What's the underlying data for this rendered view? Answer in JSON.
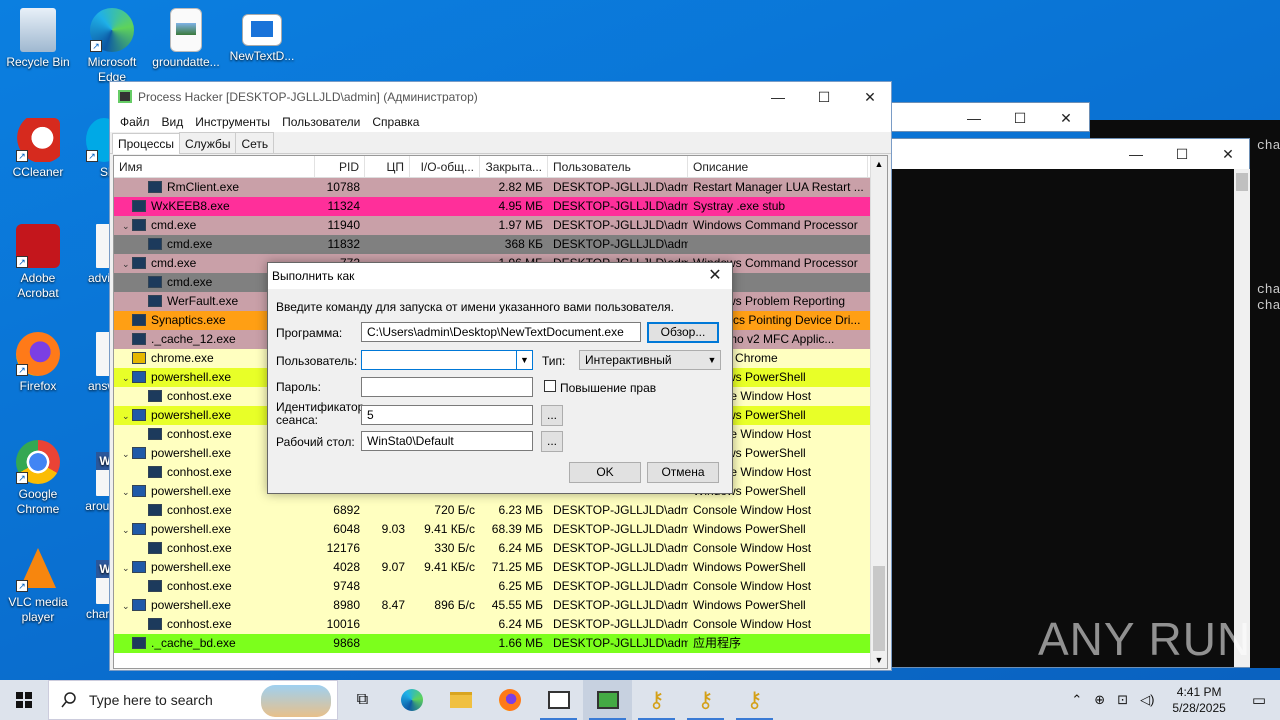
{
  "desktop_icons": [
    {
      "label": "Recycle Bin",
      "icon": "recycle-bin-icon"
    },
    {
      "label": "Microsoft Edge",
      "icon": "edge-icon"
    },
    {
      "label": "groundatte...",
      "icon": "image-file-icon"
    },
    {
      "label": "NewTextD...",
      "icon": "window-app-icon"
    },
    {
      "label": "CCleaner",
      "icon": "ccleaner-icon"
    },
    {
      "label": "Sk",
      "icon": "skype-icon"
    },
    {
      "label": "Adobe Acrobat",
      "icon": "acrobat-icon"
    },
    {
      "label": "advic",
      "icon": "document-icon"
    },
    {
      "label": "Firefox",
      "icon": "firefox-icon"
    },
    {
      "label": "answ",
      "icon": "document-icon"
    },
    {
      "label": "Google Chrome",
      "icon": "chrome-icon"
    },
    {
      "label": "aroun",
      "icon": "word-icon"
    },
    {
      "label": "VLC media player",
      "icon": "vlc-icon"
    },
    {
      "label": "charg",
      "icon": "word-icon"
    }
  ],
  "console_text": [
    "cha",
    "cha",
    "cha"
  ],
  "process_hacker": {
    "title": "Process Hacker [DESKTOP-JGLLJLD\\admin] (Администратор)",
    "menu": [
      "Файл",
      "Вид",
      "Инструменты",
      "Пользователи",
      "Справка"
    ],
    "tabs": [
      "Процессы",
      "Службы",
      "Сеть"
    ],
    "columns": [
      "Имя",
      "PID",
      "ЦП",
      "I/O-общ...",
      "Закрыта...",
      "Пользователь",
      "Описание"
    ],
    "rows": [
      {
        "name": "RmClient.exe",
        "pid": "10788",
        "cpu": "",
        "io": "",
        "priv": "2.82 МБ",
        "user": "DESKTOP-JGLLJLD\\admi",
        "desc": "Restart Manager LUA Restart ...",
        "indent": 2,
        "bg": "#c9a0a8",
        "chev": ""
      },
      {
        "name": "WxKEEB8.exe",
        "pid": "11324",
        "cpu": "",
        "io": "",
        "priv": "4.95 МБ",
        "user": "DESKTOP-JGLLJLD\\admi",
        "desc": "Systray .exe stub",
        "indent": 1,
        "bg": "#ff2f9a",
        "chev": ""
      },
      {
        "name": "cmd.exe",
        "pid": "11940",
        "cpu": "",
        "io": "",
        "priv": "1.97 МБ",
        "user": "DESKTOP-JGLLJLD\\admi",
        "desc": "Windows Command Processor",
        "indent": 1,
        "bg": "#c9a0a8",
        "chev": "v"
      },
      {
        "name": "cmd.exe",
        "pid": "11832",
        "cpu": "",
        "io": "",
        "priv": "368 КБ",
        "user": "DESKTOP-JGLLJLD\\admi",
        "desc": "",
        "indent": 2,
        "bg": "#808080",
        "chev": ""
      },
      {
        "name": "cmd.exe",
        "pid": "772",
        "cpu": "",
        "io": "",
        "priv": "1.96 МБ",
        "user": "DESKTOP-JGLLJLD\\admi",
        "desc": "Windows Command Processor",
        "indent": 1,
        "bg": "#c9a0a8",
        "chev": "v"
      },
      {
        "name": "cmd.exe",
        "pid": "",
        "cpu": "",
        "io": "",
        "priv": "",
        "user": "",
        "desc": "",
        "indent": 2,
        "bg": "#808080",
        "chev": ""
      },
      {
        "name": "WerFault.exe",
        "pid": "",
        "cpu": "",
        "io": "",
        "priv": "",
        "user": "",
        "desc": "Windows Problem Reporting",
        "indent": 2,
        "bg": "#c9a0a8",
        "chev": ""
      },
      {
        "name": "Synaptics.exe",
        "pid": "",
        "cpu": "",
        "io": "",
        "priv": "",
        "user": "",
        "desc": "Synaptics Pointing Device Dri...",
        "indent": 1,
        "bg": "#ff9f14",
        "chev": ""
      },
      {
        "name": "._cache_12.exe",
        "pid": "",
        "cpu": "",
        "io": "",
        "priv": "",
        "user": "",
        "desc": "DrvDemo v2 MFC Applic...",
        "indent": 1,
        "bg": "#c9a0a8",
        "chev": ""
      },
      {
        "name": "chrome.exe",
        "pid": "",
        "cpu": "",
        "io": "",
        "priv": "",
        "user": "",
        "desc": "Google Chrome",
        "indent": 1,
        "bg": "#ffffc0",
        "chev": ""
      },
      {
        "name": "powershell.exe",
        "pid": "",
        "cpu": "",
        "io": "",
        "priv": "",
        "user": "",
        "desc": "Windows PowerShell",
        "indent": 1,
        "bg": "#e8ff28",
        "chev": "v"
      },
      {
        "name": "conhost.exe",
        "pid": "",
        "cpu": "",
        "io": "",
        "priv": "",
        "user": "",
        "desc": "Console Window Host",
        "indent": 2,
        "bg": "#ffffc0",
        "chev": ""
      },
      {
        "name": "powershell.exe",
        "pid": "",
        "cpu": "",
        "io": "",
        "priv": "",
        "user": "",
        "desc": "Windows PowerShell",
        "indent": 1,
        "bg": "#e8ff28",
        "chev": "v"
      },
      {
        "name": "conhost.exe",
        "pid": "",
        "cpu": "",
        "io": "",
        "priv": "",
        "user": "",
        "desc": "Console Window Host",
        "indent": 2,
        "bg": "#ffffc0",
        "chev": ""
      },
      {
        "name": "powershell.exe",
        "pid": "",
        "cpu": "",
        "io": "",
        "priv": "",
        "user": "",
        "desc": "Windows PowerShell",
        "indent": 1,
        "bg": "#ffffc0",
        "chev": "v"
      },
      {
        "name": "conhost.exe",
        "pid": "",
        "cpu": "",
        "io": "",
        "priv": "",
        "user": "",
        "desc": "Console Window Host",
        "indent": 2,
        "bg": "#ffffc0",
        "chev": ""
      },
      {
        "name": "powershell.exe",
        "pid": "",
        "cpu": "",
        "io": "",
        "priv": "",
        "user": "",
        "desc": "Windows PowerShell",
        "indent": 1,
        "bg": "#ffffc0",
        "chev": "v"
      },
      {
        "name": "conhost.exe",
        "pid": "6892",
        "cpu": "",
        "io": "720 Б/с",
        "priv": "6.23 МБ",
        "user": "DESKTOP-JGLLJLD\\admi",
        "desc": "Console Window Host",
        "indent": 2,
        "bg": "#ffffc0",
        "chev": ""
      },
      {
        "name": "powershell.exe",
        "pid": "6048",
        "cpu": "9.03",
        "io": "9.41 КБ/с",
        "priv": "68.39 МБ",
        "user": "DESKTOP-JGLLJLD\\admi",
        "desc": "Windows PowerShell",
        "indent": 1,
        "bg": "#ffffc0",
        "chev": "v"
      },
      {
        "name": "conhost.exe",
        "pid": "12176",
        "cpu": "",
        "io": "330 Б/с",
        "priv": "6.24 МБ",
        "user": "DESKTOP-JGLLJLD\\admi",
        "desc": "Console Window Host",
        "indent": 2,
        "bg": "#ffffc0",
        "chev": ""
      },
      {
        "name": "powershell.exe",
        "pid": "4028",
        "cpu": "9.07",
        "io": "9.41 КБ/с",
        "priv": "71.25 МБ",
        "user": "DESKTOP-JGLLJLD\\admi",
        "desc": "Windows PowerShell",
        "indent": 1,
        "bg": "#ffffc0",
        "chev": "v"
      },
      {
        "name": "conhost.exe",
        "pid": "9748",
        "cpu": "",
        "io": "",
        "priv": "6.25 МБ",
        "user": "DESKTOP-JGLLJLD\\admi",
        "desc": "Console Window Host",
        "indent": 2,
        "bg": "#ffffc0",
        "chev": ""
      },
      {
        "name": "powershell.exe",
        "pid": "8980",
        "cpu": "8.47",
        "io": "896 Б/с",
        "priv": "45.55 МБ",
        "user": "DESKTOP-JGLLJLD\\admi",
        "desc": "Windows PowerShell",
        "indent": 1,
        "bg": "#ffffc0",
        "chev": "v"
      },
      {
        "name": "conhost.exe",
        "pid": "10016",
        "cpu": "",
        "io": "",
        "priv": "6.24 МБ",
        "user": "DESKTOP-JGLLJLD\\admi",
        "desc": "Console Window Host",
        "indent": 2,
        "bg": "#ffffc0",
        "chev": ""
      },
      {
        "name": "._cache_bd.exe",
        "pid": "9868",
        "cpu": "",
        "io": "",
        "priv": "1.66 МБ",
        "user": "DESKTOP-JGLLJLD\\admi",
        "desc": "应用程序",
        "indent": 1,
        "bg": "#7cff1c",
        "chev": ""
      }
    ]
  },
  "run_as": {
    "title": "Выполнить как",
    "intro": "Введите команду для запуска от имени указанного вами пользователя.",
    "program_label": "Программа:",
    "program_value": "C:\\Users\\admin\\Desktop\\NewTextDocument.exe",
    "browse_label": "Обзор...",
    "user_label": "Пользователь:",
    "user_value": "",
    "type_label": "Тип:",
    "type_value": "Интерактивный",
    "password_label": "Пароль:",
    "elevate_label": "Повышение прав",
    "session_label": "Идентификатор сеанса:",
    "session_value": "5",
    "desktop_label": "Рабочий стол:",
    "desktop_value": "WinSta0\\Default",
    "ellipsis": "...",
    "ok_label": "OK",
    "cancel_label": "Отмена"
  },
  "taskbar": {
    "search_placeholder": "Type here to search",
    "time": "4:41 PM",
    "date": "5/28/2025"
  },
  "watermark": "ANY RUN"
}
